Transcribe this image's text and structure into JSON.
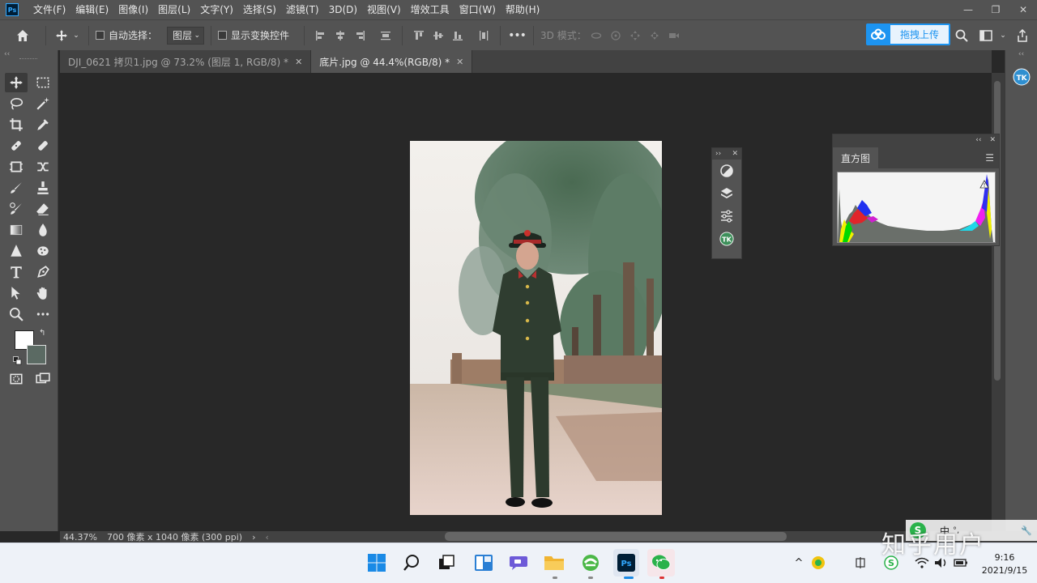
{
  "app": {
    "logo": "Ps",
    "menu": [
      "文件(F)",
      "编辑(E)",
      "图像(I)",
      "图层(L)",
      "文字(Y)",
      "选择(S)",
      "滤镜(T)",
      "3D(D)",
      "视图(V)",
      "增效工具",
      "窗口(W)",
      "帮助(H)"
    ],
    "window_controls": [
      "—",
      "❐",
      "✕"
    ]
  },
  "options": {
    "auto_select_label": "自动选择：",
    "auto_select_checked": false,
    "auto_select_target": "图层",
    "show_transform_label": "显示变换控件",
    "show_transform_checked": false,
    "more_label": "•••",
    "mode_3d_label": "3D 模式：",
    "upload_label": "拖拽上传"
  },
  "tabs": [
    {
      "title": "DJI_0621 拷贝1.jpg @ 73.2% (图层 1, RGB/8) *",
      "active": false
    },
    {
      "title": "底片.jpg @ 44.4%(RGB/8) *",
      "active": true
    }
  ],
  "status": {
    "zoom": "44.37%",
    "doc_info": "700 像素 x 1040 像素 (300 ppi)"
  },
  "panels": {
    "histogram_title": "直方图",
    "colors": {
      "foreground": "#ffffff",
      "background": "#5b6a63"
    }
  },
  "taskbar": {
    "time": "9:16",
    "date": "2021/9/15",
    "ime": "中"
  },
  "watermark": "知乎用户"
}
